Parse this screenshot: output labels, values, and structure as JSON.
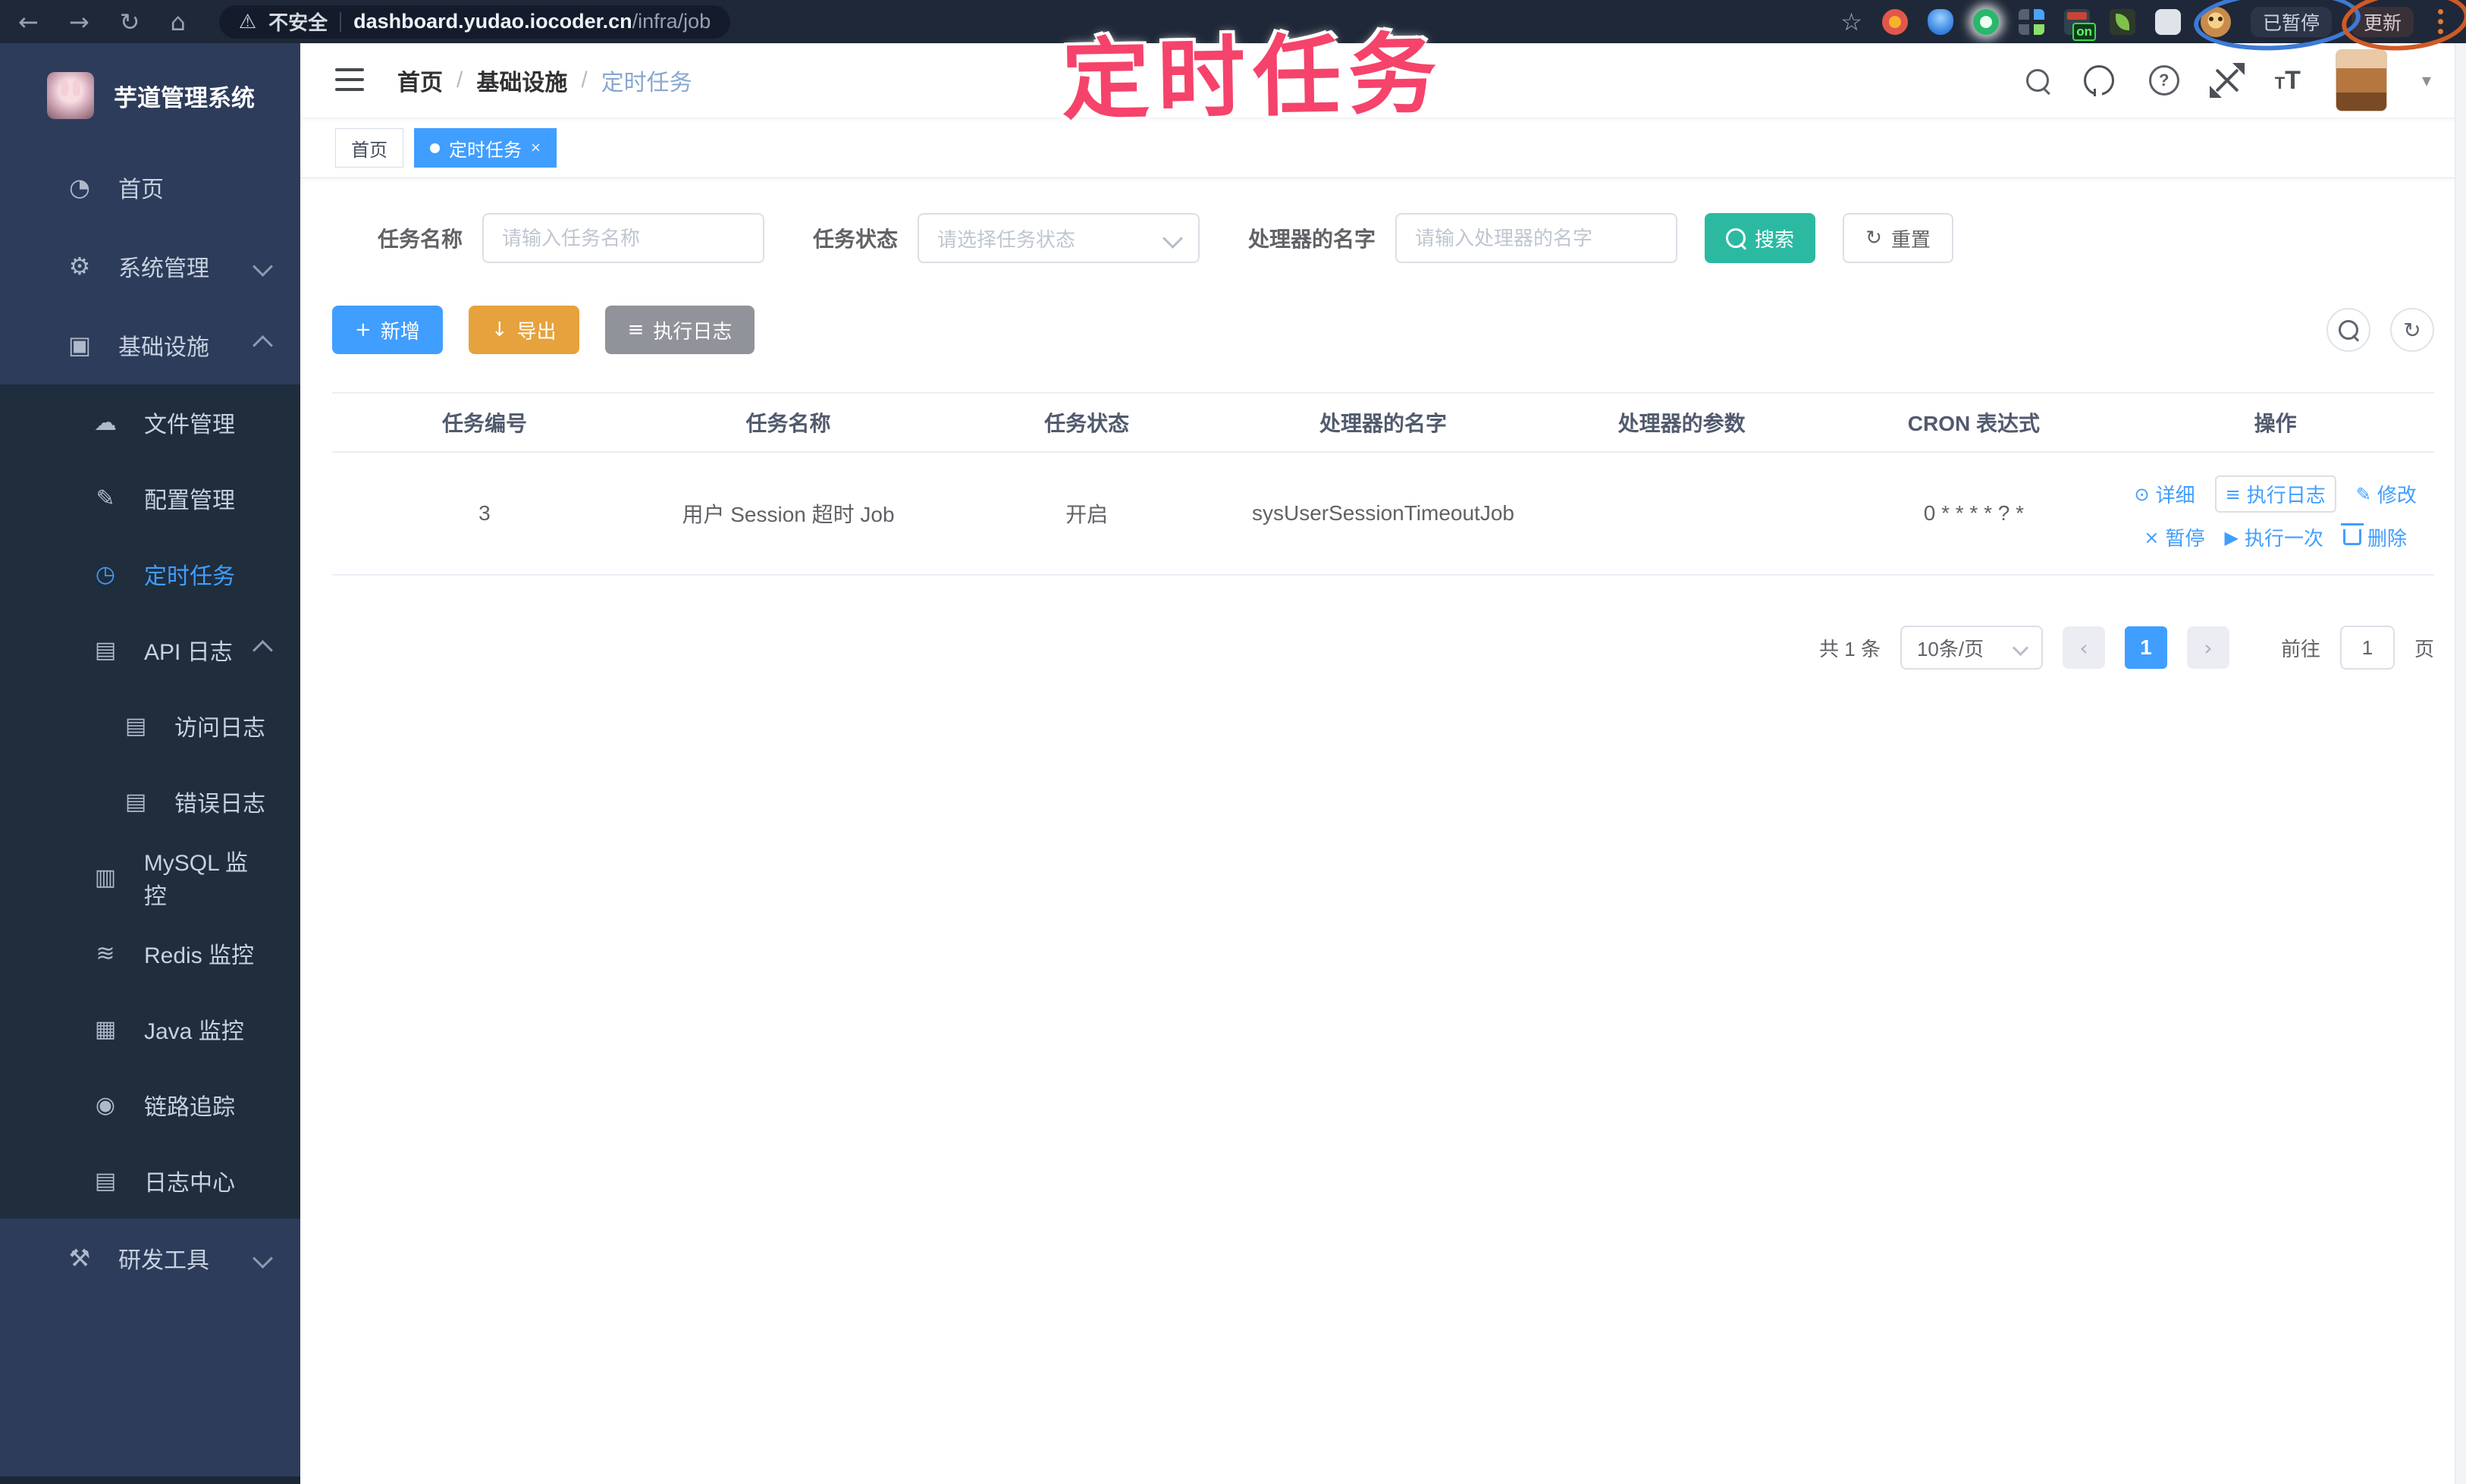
{
  "annotation": {
    "big_text": "定时任务",
    "pink": "#f5436b",
    "blue_circle": "#3d7ad3",
    "orange_circle": "#cf5a26"
  },
  "browser": {
    "security_label": "不安全",
    "url_domain": "dashboard.yudao.iocoder.cn",
    "url_path": "/infra/job",
    "ext_on_badge": "on",
    "paused_label": "已暂停",
    "update_label": "更新"
  },
  "icons": {
    "back": "←",
    "forward": "→",
    "reload": "↻",
    "home": "⌂",
    "warning": "⚠",
    "star": "☆",
    "help": "?",
    "caret": "▾",
    "textsize_small": "T",
    "textsize_big": "T",
    "plus": "+",
    "download": "↓",
    "list": "≡",
    "detail": "⊙",
    "edit": "✎",
    "pause": "×",
    "play": "▶",
    "sb_home": "◔",
    "sb_system": "⚙",
    "sb_infra": "▣",
    "sb_file": "☁",
    "sb_config": "✎",
    "sb_job": "◷",
    "sb_api_log": "▤",
    "sb_access_log": "▤",
    "sb_error_log": "▤",
    "sb_mysql": "▥",
    "sb_redis": "≋",
    "sb_java": "▦",
    "sb_trace": "◉",
    "sb_log_center": "▤",
    "sb_tools": "⚒",
    "refresh": "↻",
    "prev": "‹",
    "next": "›"
  },
  "sidebar": {
    "logo_title": "芋道管理系统",
    "home": "首页",
    "system": "系统管理",
    "infra": "基础设施",
    "sub": {
      "file": "文件管理",
      "config": "配置管理",
      "job": "定时任务",
      "api_log": "API 日志",
      "access_log": "访问日志",
      "error_log": "错误日志",
      "mysql": "MySQL 监控",
      "redis": "Redis 监控",
      "java": "Java 监控",
      "trace": "链路追踪",
      "log_center": "日志中心"
    },
    "tools": "研发工具"
  },
  "header": {
    "breadcrumb": [
      "首页",
      "基础设施",
      "定时任务"
    ],
    "separator": "/"
  },
  "tabs": {
    "home": "首页",
    "active": "定时任务",
    "close": "×"
  },
  "filters": {
    "name_label": "任务名称",
    "name_placeholder": "请输入任务名称",
    "status_label": "任务状态",
    "status_placeholder": "请选择任务状态",
    "handler_label": "处理器的名字",
    "handler_placeholder": "请输入处理器的名字",
    "search": "搜索",
    "reset": "重置"
  },
  "toolbar": {
    "add": "新增",
    "export": "导出",
    "exec_log": "执行日志"
  },
  "table": {
    "headers": [
      "任务编号",
      "任务名称",
      "任务状态",
      "处理器的名字",
      "处理器的参数",
      "CRON 表达式",
      "操作"
    ],
    "row": {
      "id": "3",
      "name": "用户 Session 超时 Job",
      "status": "开启",
      "handler": "sysUserSessionTimeoutJob",
      "param": "",
      "cron": "0 * * * * ? *",
      "ops": {
        "detail": "详细",
        "exec_log": "执行日志",
        "modify": "修改",
        "pause": "暂停",
        "run_once": "执行一次",
        "delete": "删除"
      }
    }
  },
  "pagination": {
    "total": "共 1 条",
    "size": "10条/页",
    "page": "1",
    "goto_label": "前往",
    "goto_value": "1",
    "unit": "页"
  },
  "colors": {
    "primary": "#409EFF",
    "search_teal": "#2cb9a2",
    "warning": "#e6a23c",
    "info_gray": "#909399",
    "sidebar_bg": "#2d3c5a",
    "submenu_bg": "#1f2d3d",
    "chrome_bg": "#1f2838"
  }
}
